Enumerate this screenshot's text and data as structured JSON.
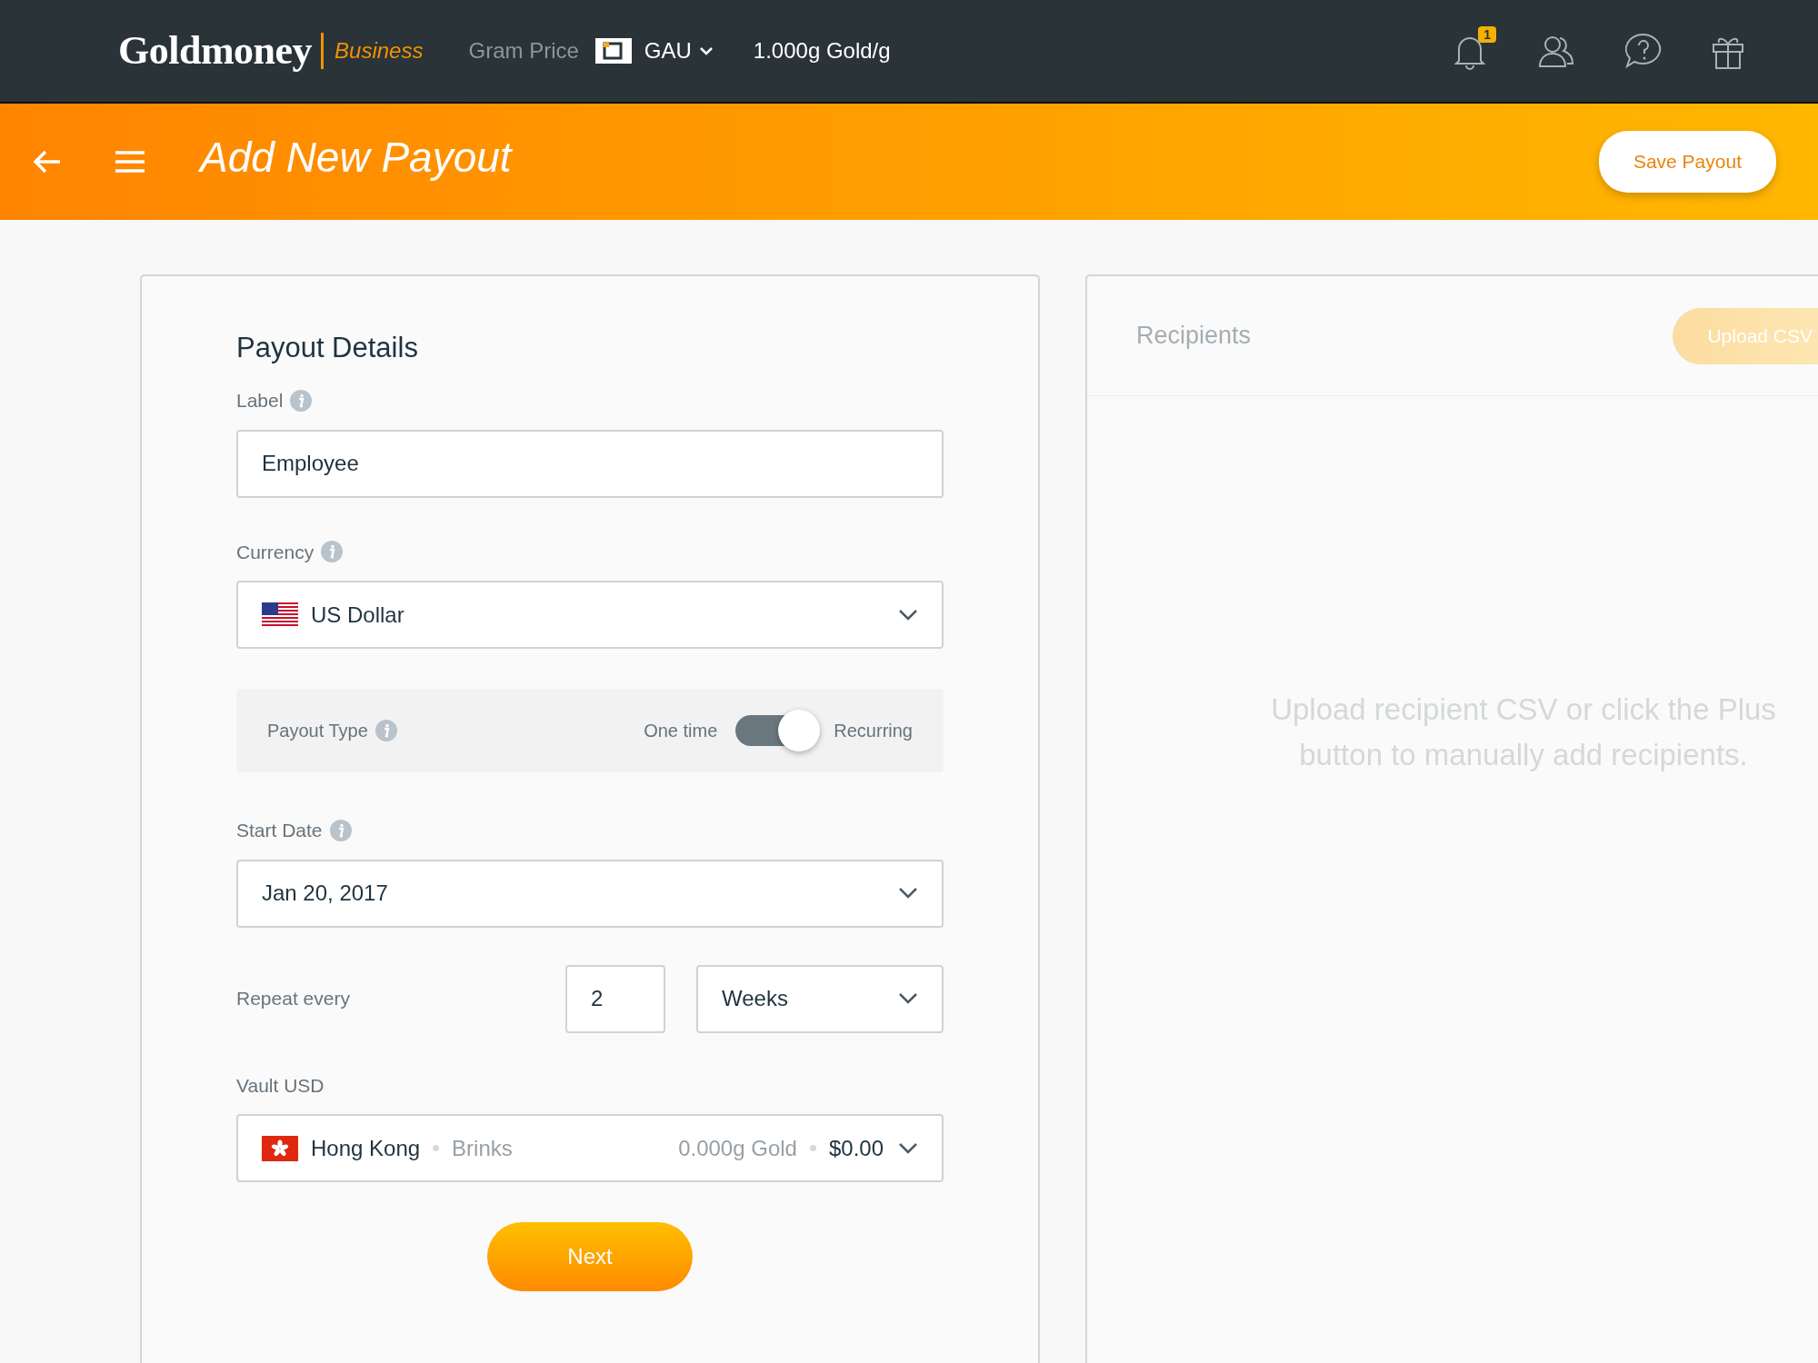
{
  "header": {
    "logo": "Goldmoney",
    "logo_suffix": "Business",
    "gram_price_label": "Gram Price",
    "currency": "GAU",
    "gram_price": "1.000g Gold/g",
    "notification_count": "1"
  },
  "page_bar": {
    "title": "Add New Payout",
    "save_button": "Save Payout"
  },
  "payout_details": {
    "title": "Payout Details",
    "label_field": {
      "label": "Label",
      "value": "Employee"
    },
    "currency_field": {
      "label": "Currency",
      "value": "US Dollar"
    },
    "payout_type": {
      "label": "Payout Type",
      "option_off": "One time",
      "option_on": "Recurring",
      "recurring": true
    },
    "start_date": {
      "label": "Start Date",
      "value": "Jan 20, 2017"
    },
    "repeat": {
      "label": "Repeat every",
      "count": "2",
      "unit": "Weeks"
    },
    "vault": {
      "label": "Vault USD",
      "location": "Hong Kong",
      "provider": "Brinks",
      "gold": "0.000g Gold",
      "amount": "$0.00"
    },
    "next_button": "Next"
  },
  "recipients": {
    "title": "Recipients",
    "upload_button": "Upload CSV",
    "empty_message": "Upload recipient CSV or click the Plus button to manually add recipients."
  }
}
